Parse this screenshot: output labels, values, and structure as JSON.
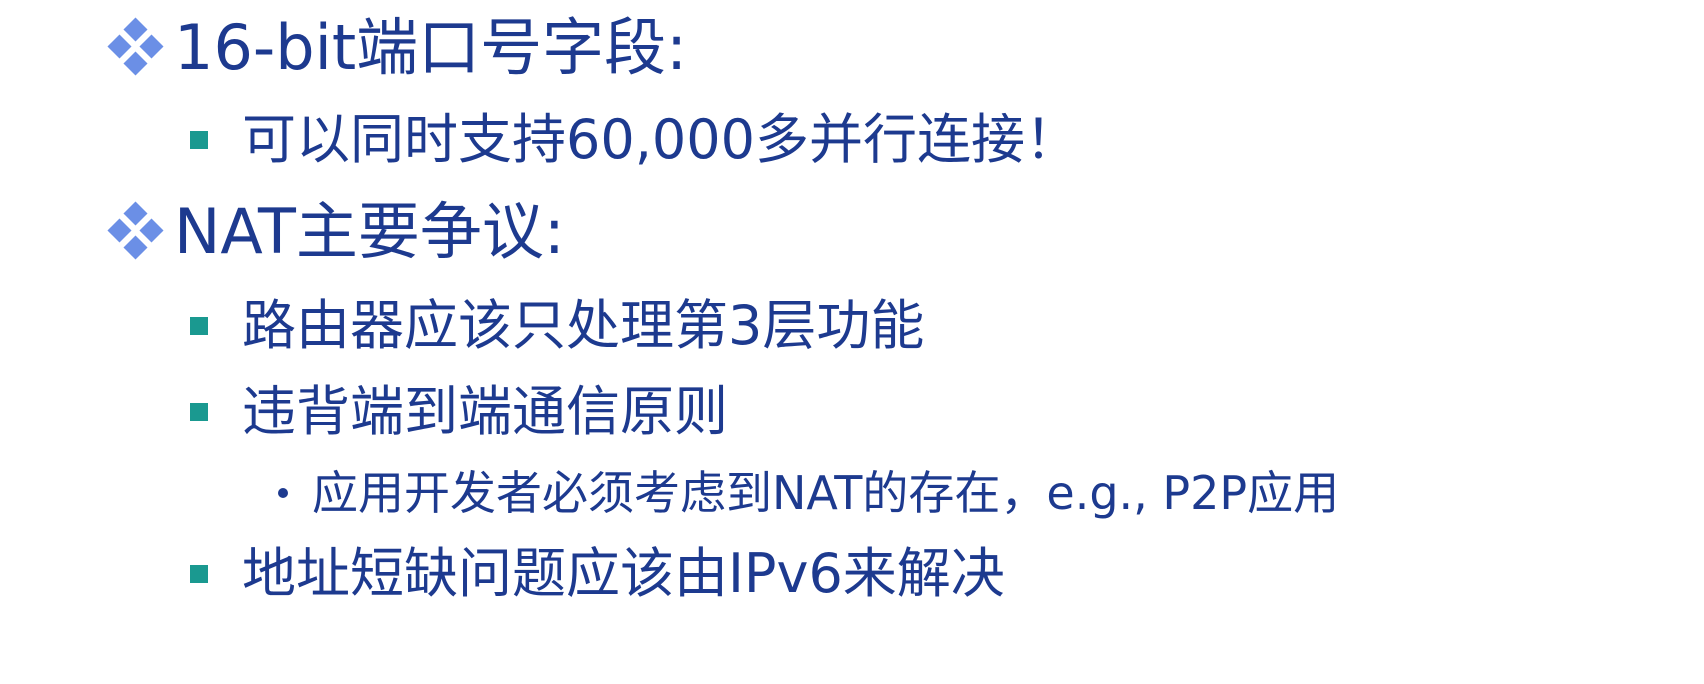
{
  "slide": {
    "items": [
      {
        "level": 1,
        "text": "16-bit端口号字段:"
      },
      {
        "level": 2,
        "text": "可以同时支持60,000多并行连接！"
      },
      {
        "level": 1,
        "text": "NAT主要争议:"
      },
      {
        "level": 2,
        "text": "路由器应该只处理第3层功能"
      },
      {
        "level": 2,
        "text": "违背端到端通信原则"
      },
      {
        "level": 3,
        "text": "应用开发者必须考虑到NAT的存在，e.g., P2P应用"
      },
      {
        "level": 2,
        "text": "地址短缺问题应该由IPv6来解决"
      }
    ]
  },
  "colors": {
    "text": "#1d3a8f",
    "level1_bullet": "#6b8fe6",
    "level2_bullet": "#1a9990",
    "level3_bullet": "#1d3a8f"
  },
  "icons": {
    "level1": "four-diamond-bullet-icon",
    "level2": "square-bullet-icon",
    "level3": "dot-bullet-icon"
  }
}
